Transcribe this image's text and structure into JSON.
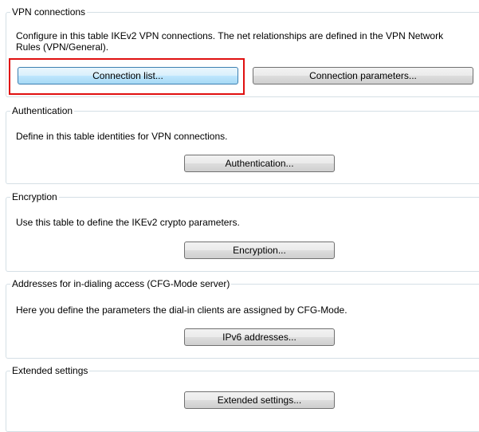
{
  "sections": {
    "vpn": {
      "legend": "VPN connections",
      "description": "Configure in this table IKEv2 VPN connections. The net relationships are defined in the VPN Network Rules (VPN/General).",
      "connection_list_label": "Connection list...",
      "connection_parameters_label": "Connection parameters..."
    },
    "authentication": {
      "legend": "Authentication",
      "description": "Define in this table identities for VPN connections.",
      "button_label": "Authentication..."
    },
    "encryption": {
      "legend": "Encryption",
      "description": "Use this table to define the IKEv2 crypto parameters.",
      "button_label": "Encryption..."
    },
    "addresses": {
      "legend": "Addresses for in-dialing access (CFG-Mode server)",
      "description": "Here you define the parameters the dial-in clients are assigned by CFG-Mode.",
      "button_label": "IPv6 addresses..."
    },
    "extended": {
      "legend": "Extended settings",
      "button_label": "Extended settings..."
    }
  },
  "highlight_color": "#e01010"
}
